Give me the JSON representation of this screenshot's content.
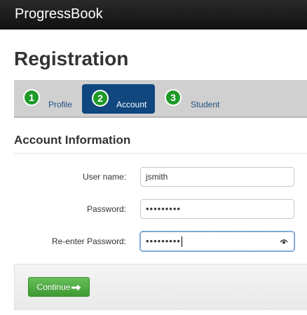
{
  "app": {
    "brand": "ProgressBook"
  },
  "page": {
    "title": "Registration"
  },
  "steps": [
    {
      "number": "1",
      "label": "Profile",
      "active": false
    },
    {
      "number": "2",
      "label": "Account",
      "active": true
    },
    {
      "number": "3",
      "label": "Student",
      "active": false
    }
  ],
  "section": {
    "title": "Account Information"
  },
  "form": {
    "username": {
      "label": "User name:",
      "value": "jsmith"
    },
    "password": {
      "label": "Password:",
      "value": "•••••••••"
    },
    "confirm_password": {
      "label": "Re-enter Password:",
      "value": "•••••••••"
    }
  },
  "actions": {
    "continue_label": "Continue"
  },
  "colors": {
    "active_step": "#10477e",
    "step_number": "#1e9a28",
    "continue_button": "#4caf3f"
  }
}
